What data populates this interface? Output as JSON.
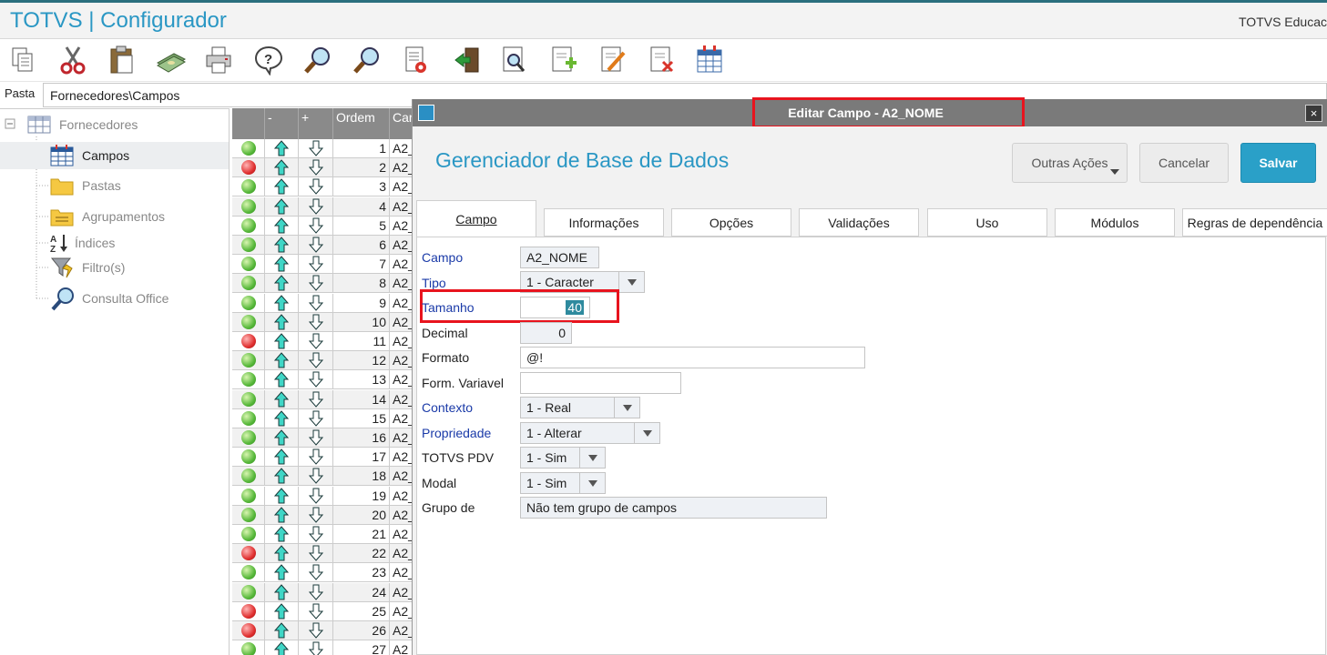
{
  "app": {
    "title": "TOTVS | Configurador",
    "right_text": "TOTVS Educaci"
  },
  "toolbar": {
    "icons": [
      "copy-icon",
      "cut-icon",
      "paste-icon",
      "money-icon",
      "print-icon",
      "help-icon",
      "search-icon",
      "search-next-icon",
      "edit-record-icon",
      "exit-icon",
      "preview-icon",
      "new-document-icon",
      "edit-document-icon",
      "delete-document-icon",
      "table-icon"
    ]
  },
  "pasta": {
    "label": "Pasta",
    "value": "Fornecedores\\Campos"
  },
  "tree": {
    "root": "Fornecedores",
    "items": [
      {
        "label": "Campos",
        "icon": "table-icon"
      },
      {
        "label": "Pastas",
        "icon": "folder-icon"
      },
      {
        "label": "Agrupamentos",
        "icon": "group-folder-icon"
      },
      {
        "label": "Índices",
        "icon": "sort-az-icon"
      },
      {
        "label": "Filtro(s)",
        "icon": "filter-icon"
      },
      {
        "label": "Consulta Office",
        "icon": "magnifier-icon"
      }
    ]
  },
  "grid": {
    "headers": [
      "",
      "-",
      "+",
      "Ordem",
      "Car"
    ],
    "rows": [
      {
        "status": "green",
        "ordem": "1",
        "campo": "A2_"
      },
      {
        "status": "red",
        "ordem": "2",
        "campo": "A2_"
      },
      {
        "status": "green",
        "ordem": "3",
        "campo": "A2_"
      },
      {
        "status": "green",
        "ordem": "4",
        "campo": "A2_"
      },
      {
        "status": "green",
        "ordem": "5",
        "campo": "A2_"
      },
      {
        "status": "green",
        "ordem": "6",
        "campo": "A2_"
      },
      {
        "status": "green",
        "ordem": "7",
        "campo": "A2_"
      },
      {
        "status": "green",
        "ordem": "8",
        "campo": "A2_"
      },
      {
        "status": "green",
        "ordem": "9",
        "campo": "A2_"
      },
      {
        "status": "green",
        "ordem": "10",
        "campo": "A2_"
      },
      {
        "status": "red",
        "ordem": "11",
        "campo": "A2_"
      },
      {
        "status": "green",
        "ordem": "12",
        "campo": "A2_"
      },
      {
        "status": "green",
        "ordem": "13",
        "campo": "A2_"
      },
      {
        "status": "green",
        "ordem": "14",
        "campo": "A2_"
      },
      {
        "status": "green",
        "ordem": "15",
        "campo": "A2_"
      },
      {
        "status": "green",
        "ordem": "16",
        "campo": "A2_"
      },
      {
        "status": "green",
        "ordem": "17",
        "campo": "A2_"
      },
      {
        "status": "green",
        "ordem": "18",
        "campo": "A2_"
      },
      {
        "status": "green",
        "ordem": "19",
        "campo": "A2_"
      },
      {
        "status": "green",
        "ordem": "20",
        "campo": "A2_"
      },
      {
        "status": "green",
        "ordem": "21",
        "campo": "A2_"
      },
      {
        "status": "red",
        "ordem": "22",
        "campo": "A2_"
      },
      {
        "status": "green",
        "ordem": "23",
        "campo": "A2_"
      },
      {
        "status": "green",
        "ordem": "24",
        "campo": "A2_"
      },
      {
        "status": "red",
        "ordem": "25",
        "campo": "A2_"
      },
      {
        "status": "red",
        "ordem": "26",
        "campo": "A2_"
      },
      {
        "status": "green",
        "ordem": "27",
        "campo": "A2_"
      }
    ]
  },
  "dialog": {
    "title": "Editar Campo - A2_NOME",
    "heading": "Gerenciador de Base de Dados",
    "buttons": {
      "outras": "Outras Ações",
      "cancelar": "Cancelar",
      "salvar": "Salvar"
    },
    "close_glyph": "×",
    "tabs": [
      "Campo",
      "Informações",
      "Opções",
      "Validações",
      "Uso",
      "Módulos",
      "Regras de dependência"
    ],
    "active_tab": "Campo",
    "fields": {
      "campo": {
        "label": "Campo",
        "value": "A2_NOME"
      },
      "tipo": {
        "label": "Tipo",
        "value": "1 - Caracter"
      },
      "tamanho": {
        "label": "Tamanho",
        "value": "40"
      },
      "decimal": {
        "label": "Decimal",
        "value": "0"
      },
      "formato": {
        "label": "Formato",
        "value": "@!"
      },
      "form_variavel": {
        "label": "Form. Variavel",
        "value": ""
      },
      "contexto": {
        "label": "Contexto",
        "value": "1 - Real"
      },
      "propriedade": {
        "label": "Propriedade",
        "value": "1 - Alterar"
      },
      "totvs_pdv": {
        "label": "TOTVS PDV",
        "value": "1 - Sim"
      },
      "modal": {
        "label": "Modal",
        "value": "1 - Sim"
      },
      "grupo": {
        "label": "Grupo de",
        "value": "Não tem grupo de campos"
      }
    }
  },
  "colors": {
    "accent": "#2a97c4",
    "save_button": "#2aa0c8",
    "highlight": "#e8141e",
    "required_label": "#1a3aa8",
    "dialog_titlebar": "#7a7a7a"
  }
}
